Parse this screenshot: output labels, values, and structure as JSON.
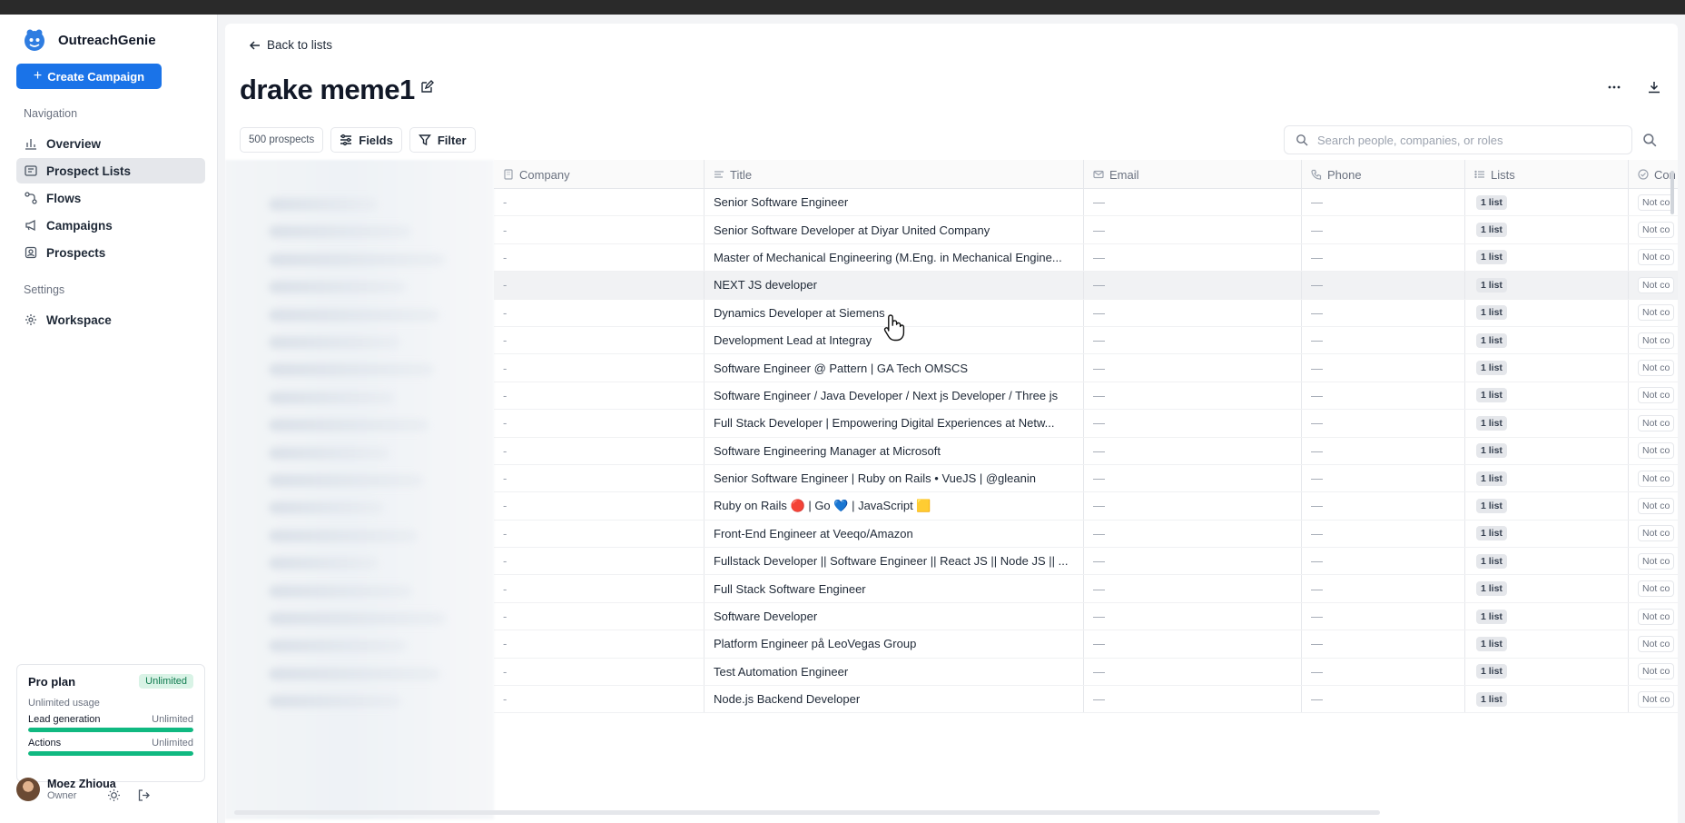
{
  "app": {
    "name": "OutreachGenie",
    "create_label": "Create Campaign"
  },
  "sidebar": {
    "navigation_label": "Navigation",
    "items": [
      {
        "label": "Overview",
        "icon": "bar-chart-icon",
        "active": false
      },
      {
        "label": "Prospect Lists",
        "icon": "list-icon",
        "active": true
      },
      {
        "label": "Flows",
        "icon": "flow-icon",
        "active": false
      },
      {
        "label": "Campaigns",
        "icon": "megaphone-icon",
        "active": false
      },
      {
        "label": "Prospects",
        "icon": "contact-icon",
        "active": false
      }
    ],
    "settings_label": "Settings",
    "settings_items": [
      {
        "label": "Workspace",
        "icon": "gear-icon"
      }
    ]
  },
  "plan": {
    "title": "Pro plan",
    "badge": "Unlimited",
    "sub": "Unlimited usage",
    "rows": [
      {
        "label": "Lead generation",
        "value": "Unlimited",
        "fill": 1.0
      },
      {
        "label": "Actions",
        "value": "Unlimited",
        "fill": 1.0
      }
    ]
  },
  "user": {
    "name": "Moez Zhioua",
    "role": "Owner"
  },
  "header": {
    "back_label": "Back to lists",
    "title": "drake meme1"
  },
  "toolbar": {
    "count": "500 prospects",
    "fields_label": "Fields",
    "filter_label": "Filter"
  },
  "search": {
    "placeholder": "Search people, companies, or roles"
  },
  "table": {
    "columns": [
      "Company",
      "Title",
      "Email",
      "Phone",
      "Lists",
      "Con"
    ],
    "rows": [
      {
        "company": "-",
        "title": "Senior Software Engineer",
        "email": "—",
        "phone": "—",
        "lists": "1 list",
        "con": "Not co"
      },
      {
        "company": "-",
        "title": "Senior Software Developer at Diyar United Company",
        "email": "—",
        "phone": "—",
        "lists": "1 list",
        "con": "Not co"
      },
      {
        "company": "-",
        "title": "Master of Mechanical Engineering (M.Eng. in Mechanical Engine...",
        "email": "—",
        "phone": "—",
        "lists": "1 list",
        "con": "Not co"
      },
      {
        "company": "-",
        "title": "NEXT JS developer",
        "email": "—",
        "phone": "—",
        "lists": "1 list",
        "con": "Not co"
      },
      {
        "company": "-",
        "title": "Dynamics Developer at Siemens",
        "email": "—",
        "phone": "—",
        "lists": "1 list",
        "con": "Not co"
      },
      {
        "company": "-",
        "title": "Development Lead at Integray",
        "email": "—",
        "phone": "—",
        "lists": "1 list",
        "con": "Not co"
      },
      {
        "company": "-",
        "title": "Software Engineer @ Pattern | GA Tech OMSCS",
        "email": "—",
        "phone": "—",
        "lists": "1 list",
        "con": "Not co"
      },
      {
        "company": "-",
        "title": "Software Engineer / Java Developer / Next js Developer / Three js",
        "email": "—",
        "phone": "—",
        "lists": "1 list",
        "con": "Not co"
      },
      {
        "company": "-",
        "title": "Full Stack Developer | Empowering Digital Experiences at Netw...",
        "email": "—",
        "phone": "—",
        "lists": "1 list",
        "con": "Not co"
      },
      {
        "company": "-",
        "title": "Software Engineering Manager at Microsoft",
        "email": "—",
        "phone": "—",
        "lists": "1 list",
        "con": "Not co"
      },
      {
        "company": "-",
        "title": "Senior Software Engineer | Ruby on Rails • VueJS | @gleanin",
        "email": "—",
        "phone": "—",
        "lists": "1 list",
        "con": "Not co"
      },
      {
        "company": "-",
        "title": "Ruby on Rails 🔴 | Go 💙 | JavaScript 🟨",
        "email": "—",
        "phone": "—",
        "lists": "1 list",
        "con": "Not co"
      },
      {
        "company": "-",
        "title": "Front-End Engineer at Veeqo/Amazon",
        "email": "—",
        "phone": "—",
        "lists": "1 list",
        "con": "Not co"
      },
      {
        "company": "-",
        "title": "Fullstack Developer || Software Engineer || React JS || Node JS || ...",
        "email": "—",
        "phone": "—",
        "lists": "1 list",
        "con": "Not co"
      },
      {
        "company": "-",
        "title": "Full Stack Software Engineer",
        "email": "—",
        "phone": "—",
        "lists": "1 list",
        "con": "Not co"
      },
      {
        "company": "-",
        "title": "Software Developer",
        "email": "—",
        "phone": "—",
        "lists": "1 list",
        "con": "Not co"
      },
      {
        "company": "-",
        "title": "Platform Engineer på LeoVegas Group",
        "email": "—",
        "phone": "—",
        "lists": "1 list",
        "con": "Not co"
      },
      {
        "company": "-",
        "title": "Test Automation Engineer",
        "email": "—",
        "phone": "—",
        "lists": "1 list",
        "con": "Not co"
      },
      {
        "company": "-",
        "title": "Node.js Backend Developer",
        "email": "—",
        "phone": "—",
        "lists": "1 list",
        "con": "Not co"
      }
    ]
  },
  "colors": {
    "accent": "#1a73e8",
    "success": "#10b981",
    "hover_row": "#f1f2f4"
  }
}
